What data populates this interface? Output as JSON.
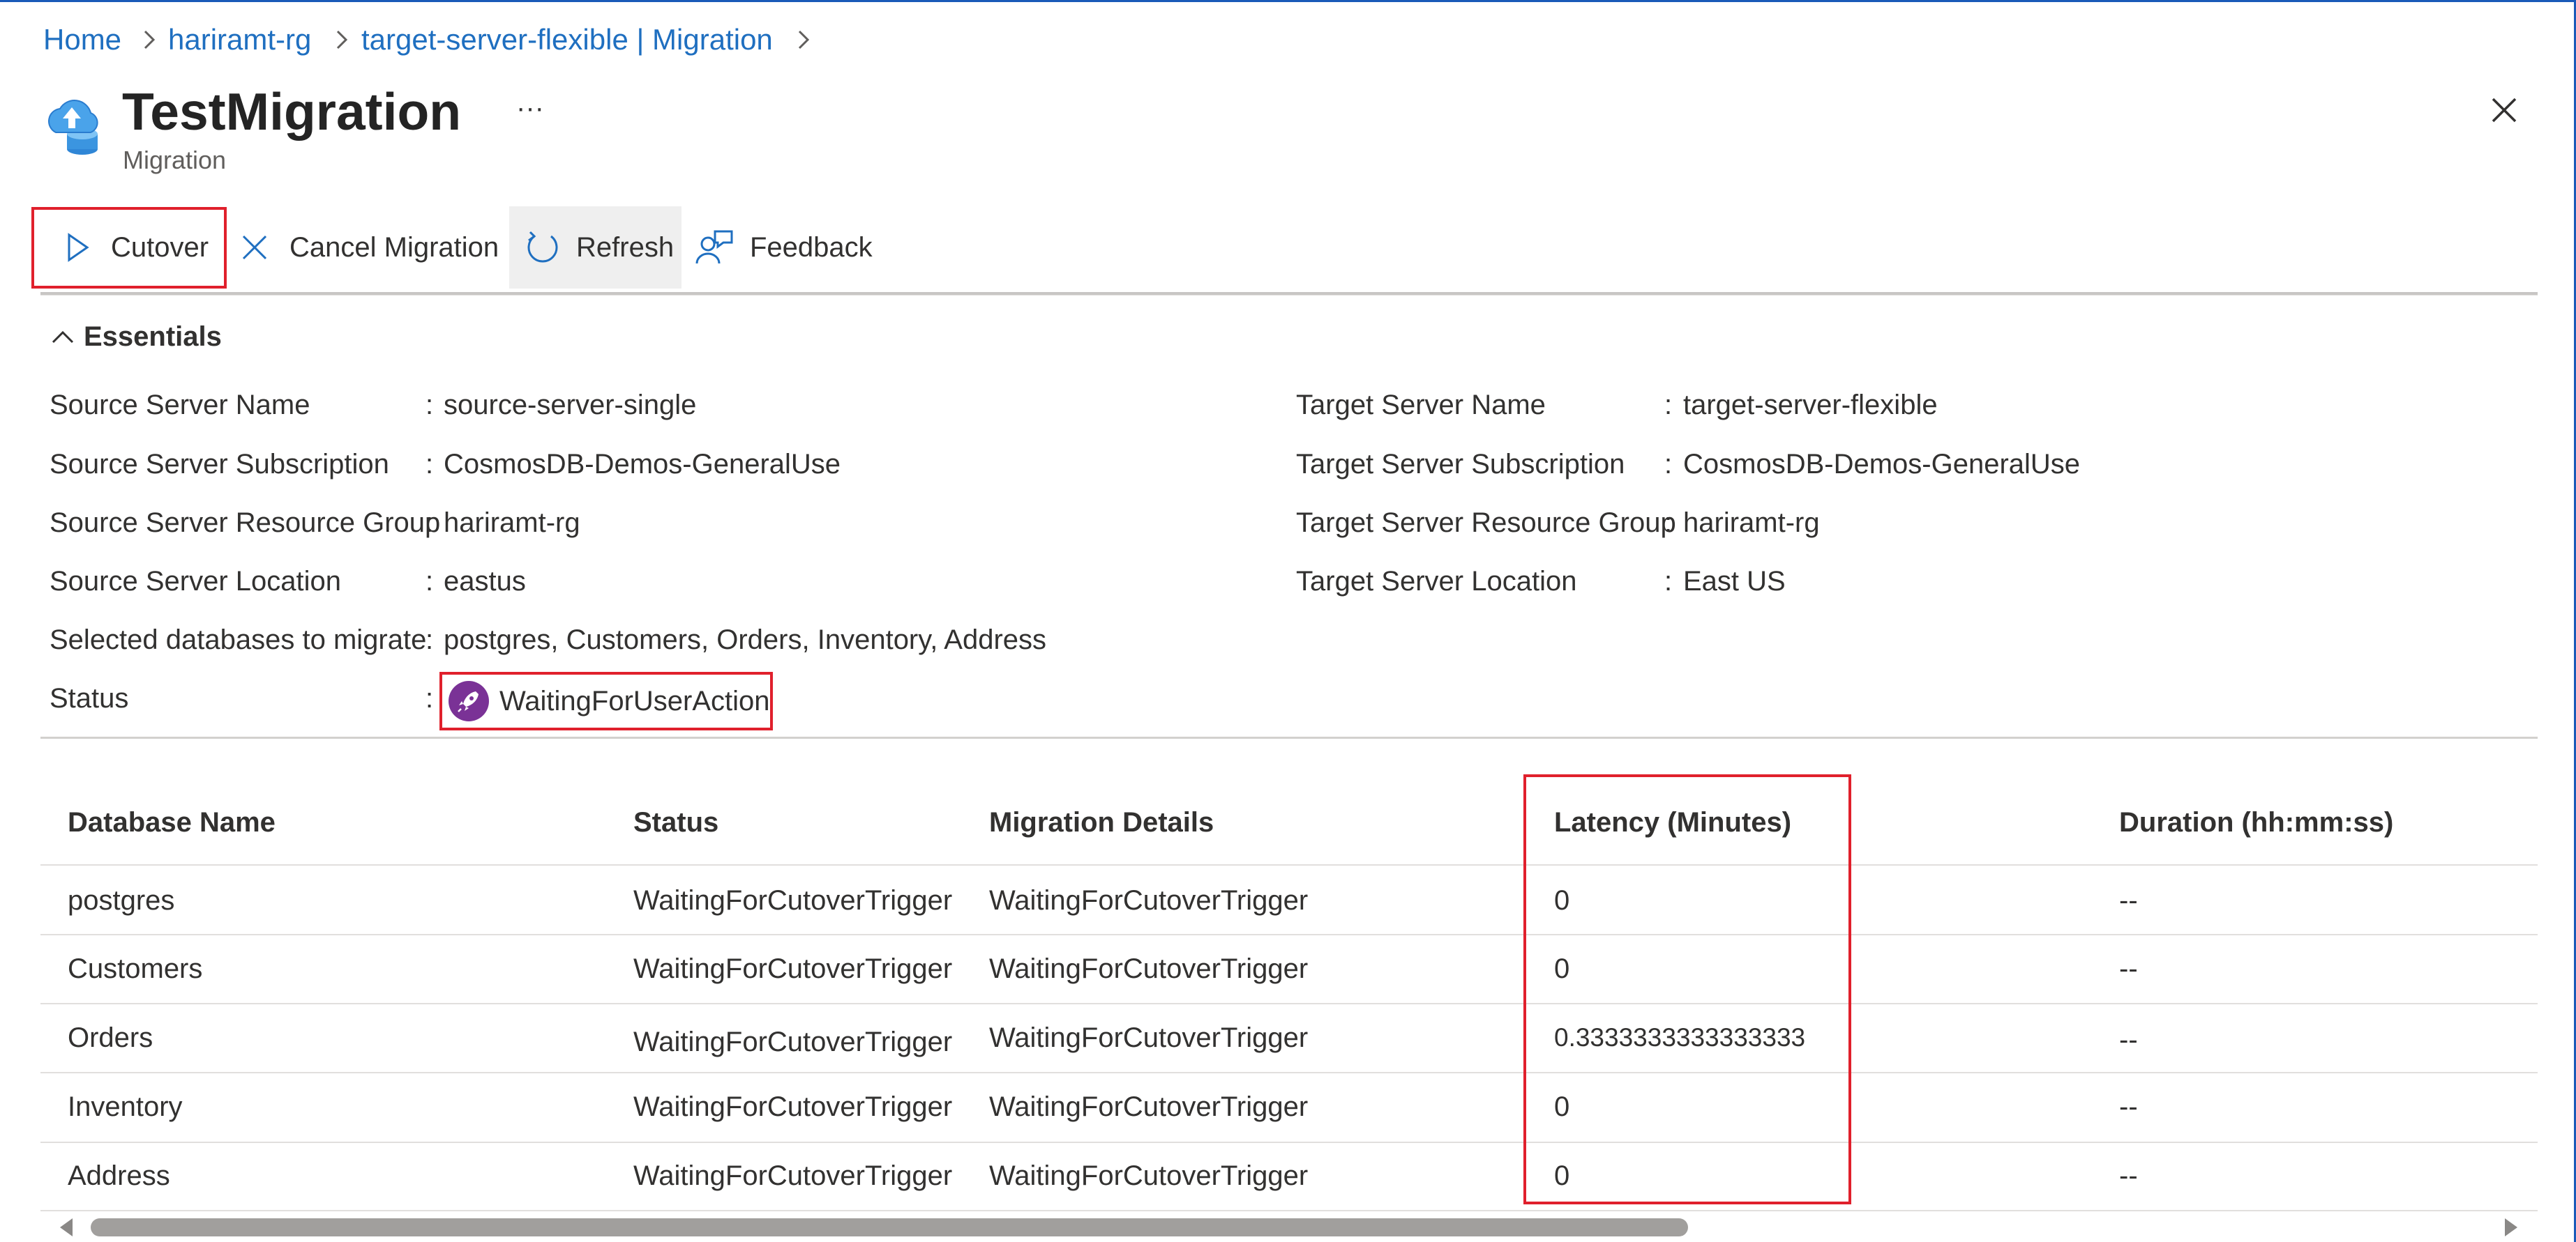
{
  "breadcrumb": {
    "items": [
      "Home",
      "hariramt-rg",
      "target-server-flexible | Migration"
    ]
  },
  "header": {
    "title": "TestMigration",
    "subtitle": "Migration",
    "more": "···"
  },
  "toolbar": {
    "cutover": "Cutover",
    "cancel_migration": "Cancel Migration",
    "refresh": "Refresh",
    "feedback": "Feedback"
  },
  "essentials": {
    "heading": "Essentials",
    "source": [
      {
        "label": "Source Server Name",
        "value": "source-server-single"
      },
      {
        "label": "Source Server Subscription",
        "value": "CosmosDB-Demos-GeneralUse"
      },
      {
        "label": "Source Server Resource Group",
        "value": "hariramt-rg"
      },
      {
        "label": "Source Server Location",
        "value": "eastus"
      },
      {
        "label": "Selected databases to migrate",
        "value": "postgres, Customers, Orders, Inventory, Address"
      },
      {
        "label": "Status",
        "value": "WaitingForUserAction"
      }
    ],
    "target": [
      {
        "label": "Target Server Name",
        "value": "target-server-flexible"
      },
      {
        "label": "Target Server Subscription",
        "value": "CosmosDB-Demos-GeneralUse"
      },
      {
        "label": "Target Server Resource Group",
        "value": "hariramt-rg"
      },
      {
        "label": "Target Server Location",
        "value": "East US"
      }
    ]
  },
  "table": {
    "headers": [
      "Database Name",
      "Status",
      "Migration Details",
      "Latency (Minutes)",
      "Duration (hh:mm:ss)"
    ],
    "rows": [
      {
        "name": "postgres",
        "status": "WaitingForCutoverTrigger",
        "details": "WaitingForCutoverTrigger",
        "latency": "0",
        "duration": "--"
      },
      {
        "name": "Customers",
        "status": "WaitingForCutoverTrigger",
        "details": "WaitingForCutoverTrigger",
        "latency": "0",
        "duration": "--"
      },
      {
        "name": "Orders",
        "status": "WaitingForCutoverTrigger",
        "details": "WaitingForCutoverTrigger",
        "latency": "0.3333333333333333",
        "duration": "--"
      },
      {
        "name": "Inventory",
        "status": "WaitingForCutoverTrigger",
        "details": "WaitingForCutoverTrigger",
        "latency": "0",
        "duration": "--"
      },
      {
        "name": "Address",
        "status": "WaitingForCutoverTrigger",
        "details": "WaitingForCutoverTrigger",
        "latency": "0",
        "duration": "--"
      }
    ]
  },
  "colors": {
    "link": "#1f6fc0",
    "highlight_border": "#e0202c",
    "status_icon_bg": "#7a3296",
    "top_border": "#1a5ab8"
  },
  "icons": {
    "app": "cloud-upload-database-icon",
    "cutover": "play-outline-icon",
    "cancel": "close-icon",
    "refresh": "refresh-icon",
    "feedback": "feedback-person-icon",
    "close": "close-icon",
    "essentials_toggle": "chevron-up-icon",
    "status": "rocket-icon"
  }
}
